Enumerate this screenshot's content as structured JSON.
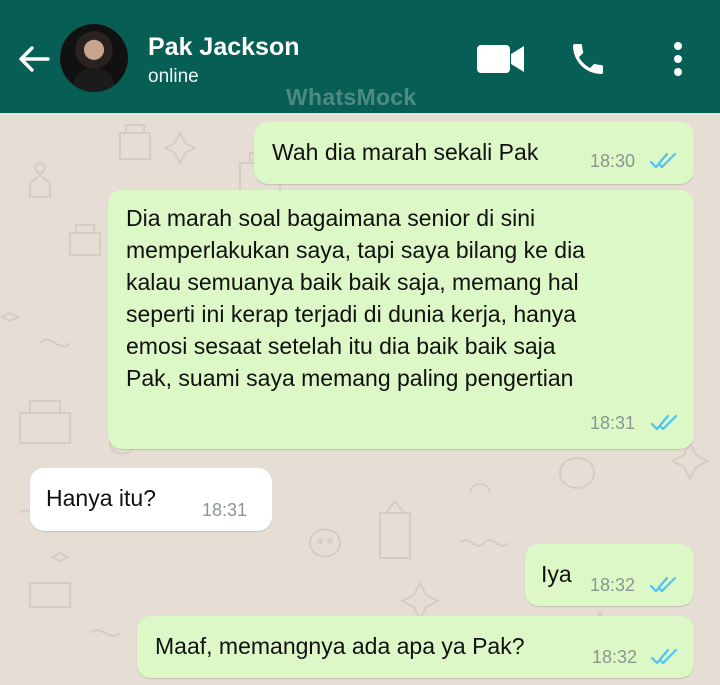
{
  "header": {
    "contact_name": "Pak Jackson",
    "status": "online",
    "watermark": "WhatsMock",
    "icons": [
      "back-arrow-icon",
      "video-call-icon",
      "phone-call-icon",
      "more-options-icon"
    ]
  },
  "colors": {
    "header_bg": "#075e54",
    "outgoing_bubble": "#dcf8c6",
    "incoming_bubble": "#ffffff",
    "chat_bg": "#e6ded4",
    "read_ticks": "#4fc3f7"
  },
  "messages": [
    {
      "direction": "outgoing",
      "text": "Wah dia marah sekali Pak",
      "time": "18:30",
      "read": true
    },
    {
      "direction": "outgoing",
      "lines": [
        "Dia marah soal bagaimana senior di sini",
        "memperlakukan saya, tapi saya bilang ke dia",
        "kalau semuanya baik baik saja, memang hal",
        "seperti ini kerap terjadi di dunia kerja, hanya",
        "emosi sesaat setelah itu dia baik baik saja",
        "Pak, suami saya memang paling pengertian"
      ],
      "time": "18:31",
      "read": true
    },
    {
      "direction": "incoming",
      "text": "Hanya itu?",
      "time": "18:31"
    },
    {
      "direction": "outgoing",
      "text": "Iya",
      "time": "18:32",
      "read": true
    },
    {
      "direction": "outgoing",
      "text": "Maaf, memangnya ada apa ya Pak?",
      "time": "18:32",
      "read": true
    }
  ]
}
